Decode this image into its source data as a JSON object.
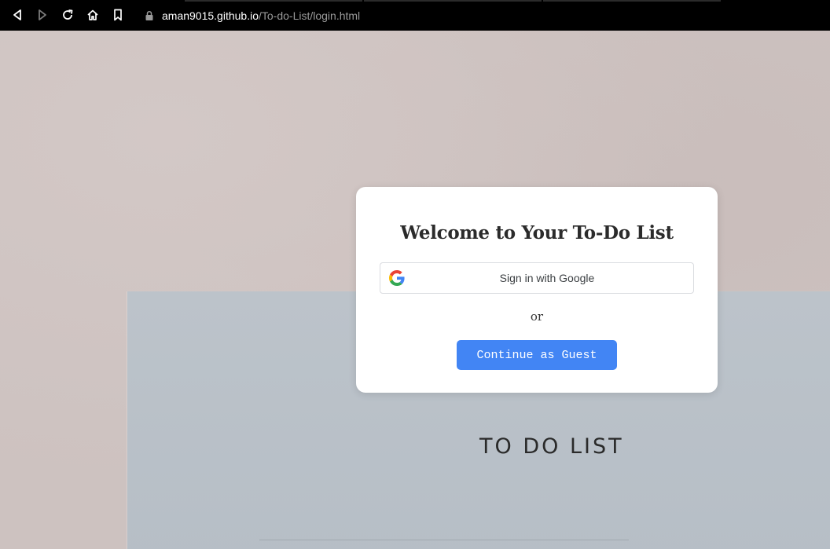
{
  "browser": {
    "url_host": "aman9015.github.io",
    "url_path": "/To-do-List/login.html",
    "icons": {
      "back": "back-arrow-icon",
      "forward": "forward-arrow-icon",
      "reload": "reload-icon",
      "home": "home-icon",
      "bookmark": "bookmark-icon",
      "lock": "lock-icon"
    }
  },
  "login_card": {
    "title": "Welcome to Your To-Do List",
    "google_button_label": "Sign in with Google",
    "divider_text": "or",
    "guest_button_label": "Continue as Guest"
  },
  "background": {
    "paper_text": "TO DO LIST"
  },
  "colors": {
    "accent": "#4285f4",
    "browser_bar": "#000000",
    "background_top": "#cdc2c0",
    "background_paper": "#b9c1c8"
  }
}
